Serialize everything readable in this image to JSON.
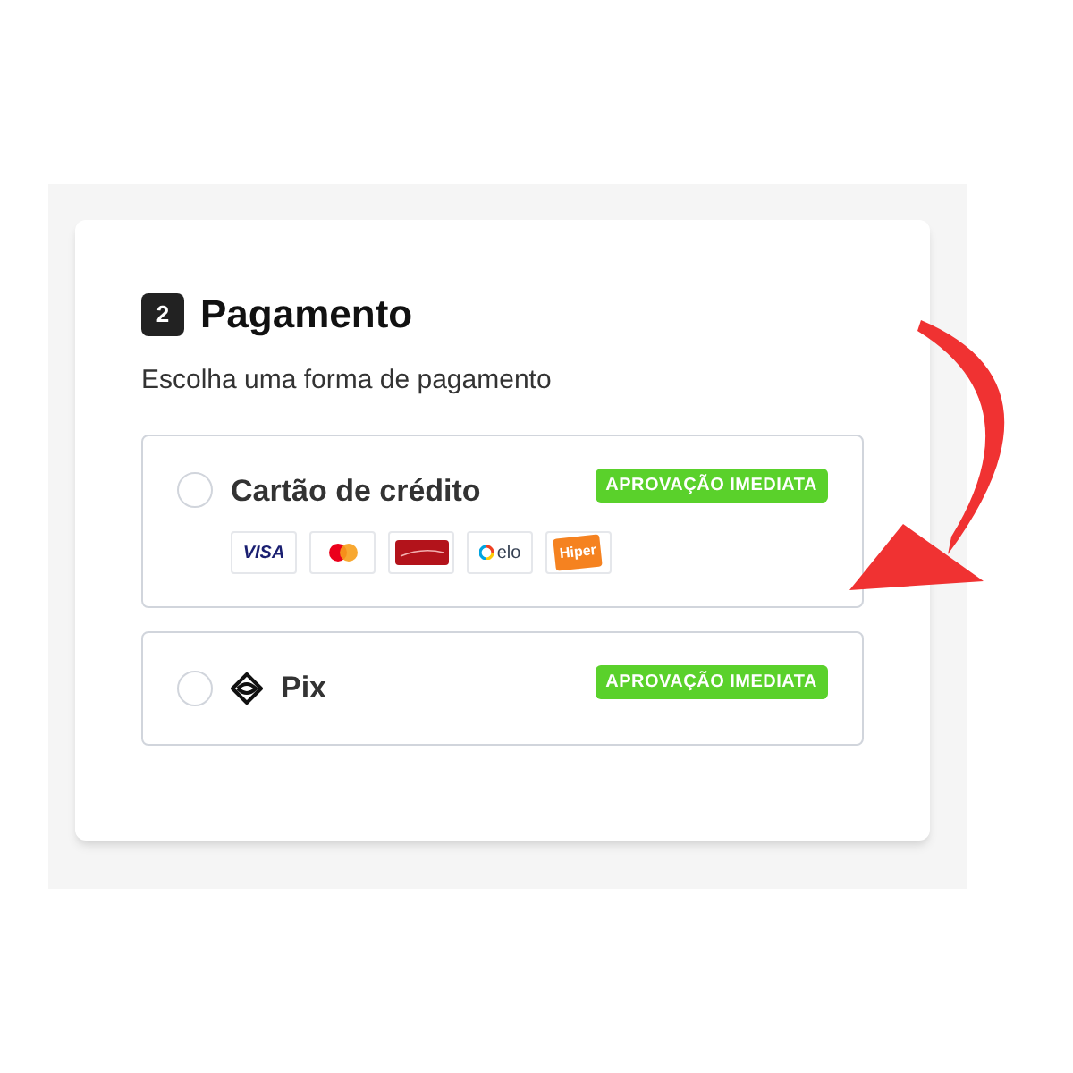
{
  "step": "2",
  "title": "Pagamento",
  "subtitle": "Escolha uma forma de pagamento",
  "options": [
    {
      "kind": "card",
      "label": "Cartão de crédito",
      "selected": false,
      "badge": "APROVAÇÃO IMEDIATA",
      "brands": [
        {
          "kind": "visa",
          "text": "VISA"
        },
        {
          "kind": "mastercard"
        },
        {
          "kind": "hipercard"
        },
        {
          "kind": "elo",
          "text": "elo"
        },
        {
          "kind": "hiper",
          "text": "Hiper"
        }
      ]
    },
    {
      "kind": "pix",
      "label": "Pix",
      "selected": false,
      "badge": "APROVAÇÃO IMEDIATA"
    }
  ]
}
